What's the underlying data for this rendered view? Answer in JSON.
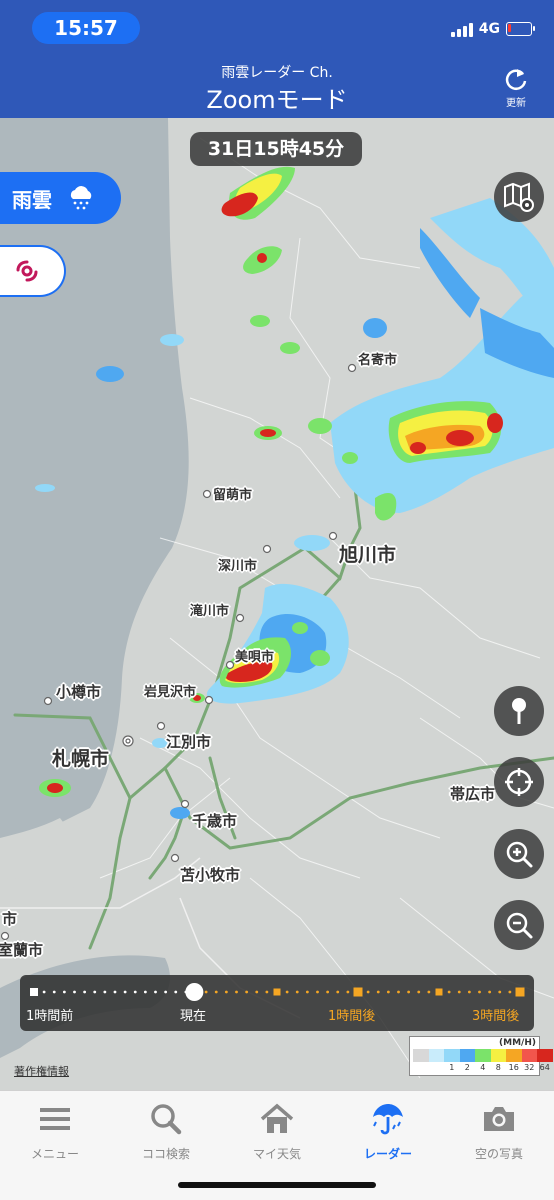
{
  "status_bar": {
    "time": "15:57",
    "network": "4G"
  },
  "header": {
    "subtitle": "雨雲レーダー Ch.",
    "title": "Zoomモード",
    "refresh_label": "更新",
    "refresh_icon": "refresh-icon"
  },
  "map": {
    "timestamp": "31日15時45分",
    "labels": [
      {
        "text": "名寄市",
        "size": "s"
      },
      {
        "text": "留萌市",
        "size": "s"
      },
      {
        "text": "旭川市",
        "size": "l"
      },
      {
        "text": "深川市",
        "size": "s"
      },
      {
        "text": "滝川市",
        "size": "s"
      },
      {
        "text": "美唄市",
        "size": "s"
      },
      {
        "text": "小樽市",
        "size": "m"
      },
      {
        "text": "岩見沢市",
        "size": "s"
      },
      {
        "text": "江別市",
        "size": "m"
      },
      {
        "text": "札幌市",
        "size": "l"
      },
      {
        "text": "帯広市",
        "size": "m"
      },
      {
        "text": "千歳市",
        "size": "m"
      },
      {
        "text": "苫小牧市",
        "size": "m"
      },
      {
        "text": "市",
        "size": "m"
      },
      {
        "text": "室蘭市",
        "size": "m"
      }
    ],
    "copyright": "著作権情報"
  },
  "layers": {
    "rain": {
      "label": "雨雲",
      "icon": "rain-cloud-icon"
    },
    "typhoon": {
      "icon": "typhoon-icon"
    }
  },
  "controls": [
    "map-settings-icon",
    "pin-icon",
    "crosshair-icon",
    "zoom-in-icon",
    "zoom-out-icon"
  ],
  "timeline": {
    "labels": [
      "1時間前",
      "現在",
      "1時間後",
      "3時間後"
    ],
    "current_position": 0.33,
    "colors": {
      "past": "#ffffff",
      "future": "#f5a623"
    }
  },
  "legend": {
    "unit": "(MM/H)",
    "values": [
      "1",
      "2",
      "4",
      "8",
      "16",
      "32",
      "64"
    ],
    "colors": [
      "#d8d8d8",
      "#c9ecfb",
      "#92d8f8",
      "#4fa8f1",
      "#7be36a",
      "#f5f042",
      "#f5a623",
      "#f2554c",
      "#d7261e"
    ]
  },
  "tabs": [
    {
      "label": "メニュー",
      "icon": "menu-icon"
    },
    {
      "label": "ココ検索",
      "icon": "search-icon"
    },
    {
      "label": "マイ天気",
      "icon": "home-icon"
    },
    {
      "label": "レーダー",
      "icon": "umbrella-icon",
      "active": true
    },
    {
      "label": "空の写真",
      "icon": "camera-icon"
    }
  ],
  "colors": {
    "header": "#2f58b8",
    "accent": "#1d6ff3"
  }
}
